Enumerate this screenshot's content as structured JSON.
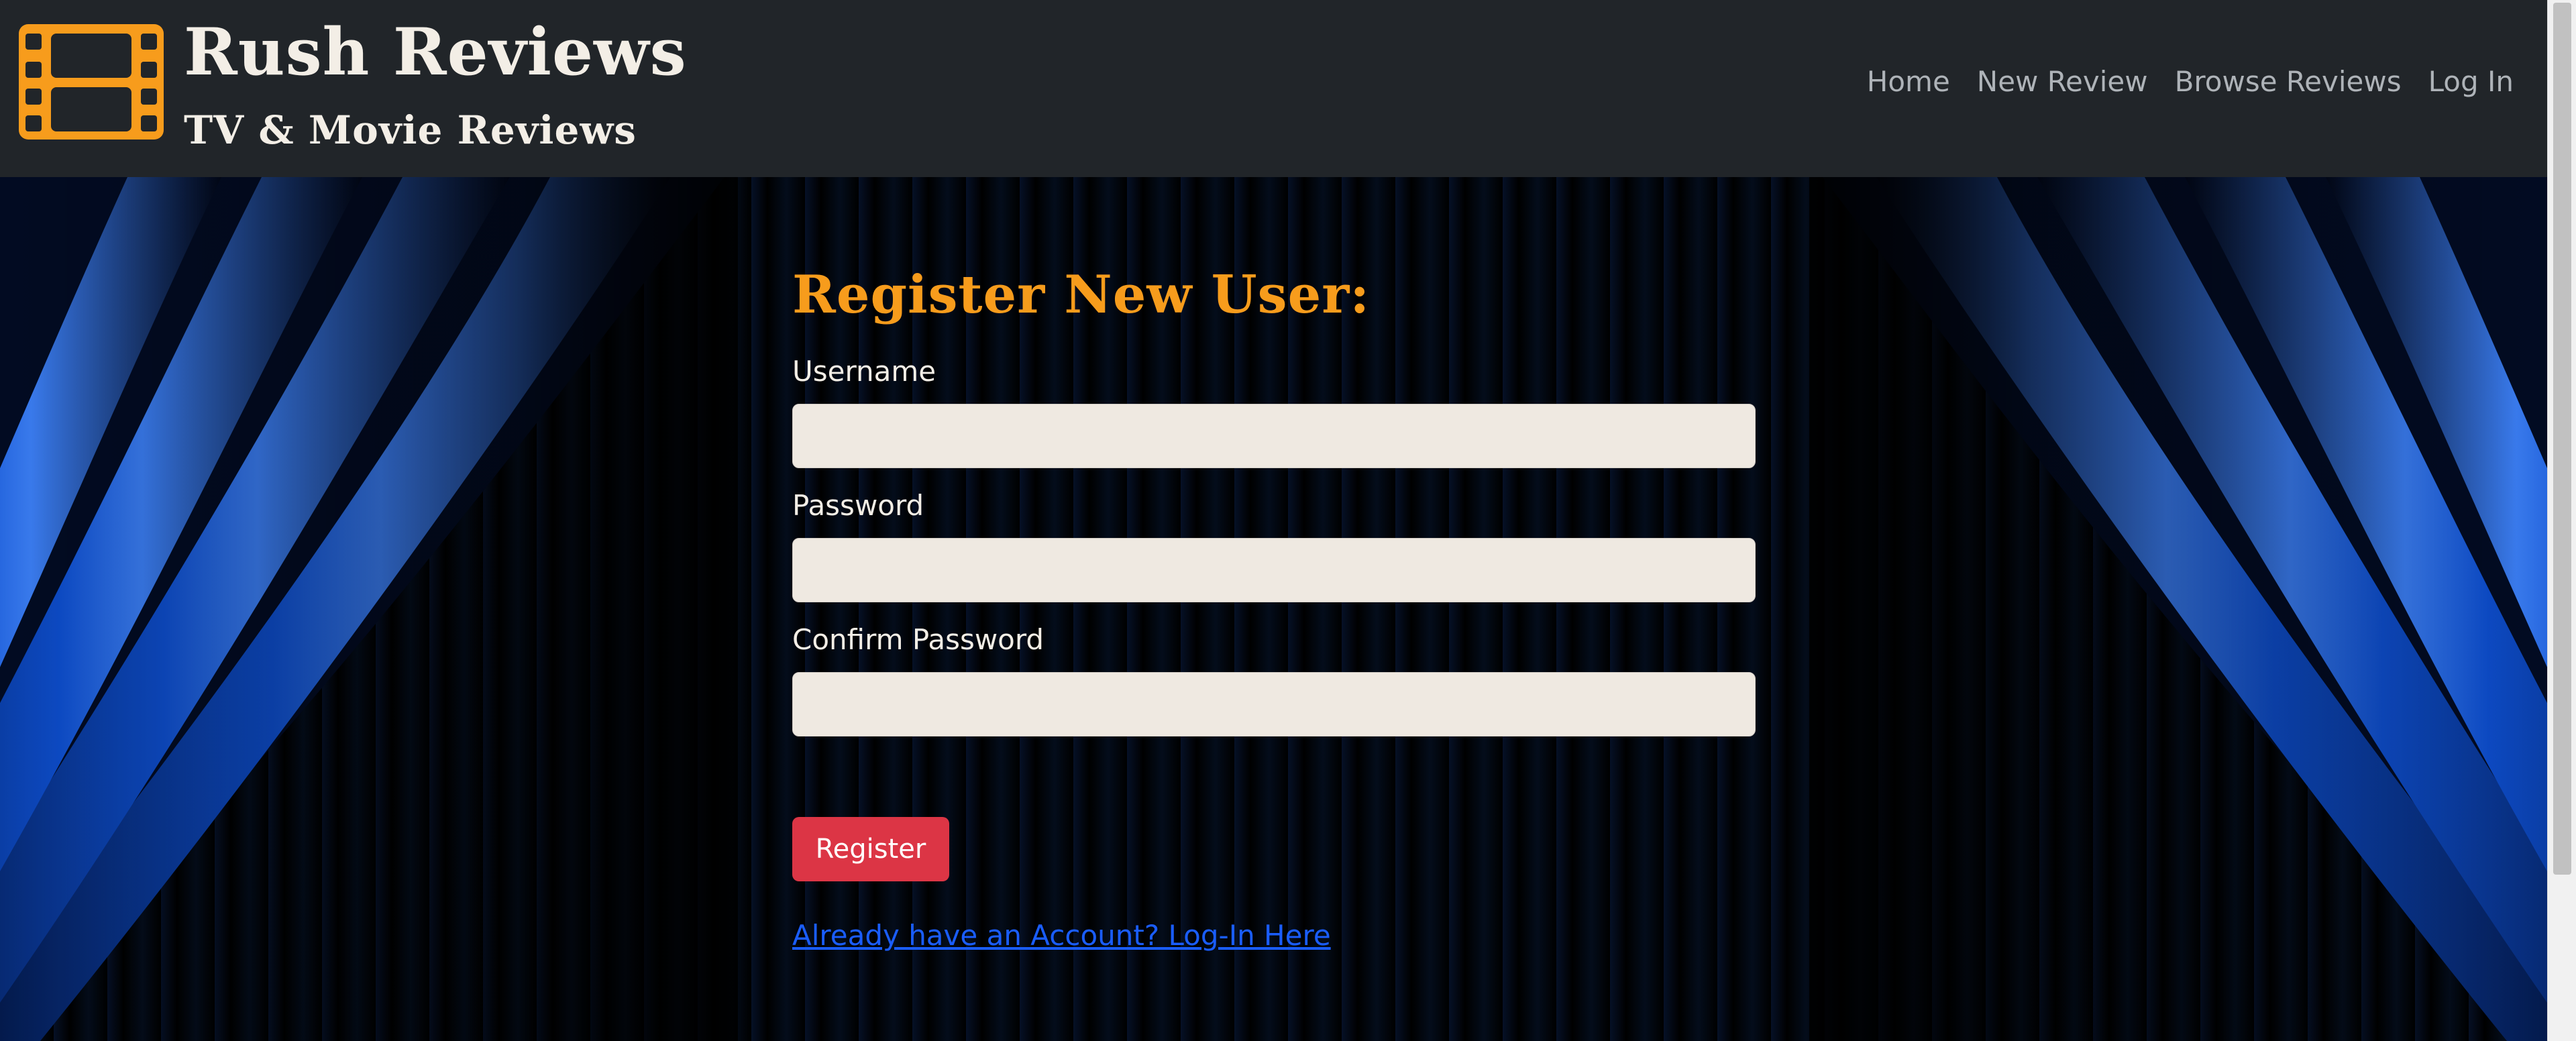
{
  "brand": {
    "title": "Rush Reviews",
    "subtitle": "TV & Movie Reviews",
    "icon": "film-strip-icon",
    "accent_color": "#f79c1c"
  },
  "nav": {
    "items": [
      {
        "label": "Home"
      },
      {
        "label": "New Review"
      },
      {
        "label": "Browse Reviews"
      },
      {
        "label": "Log In"
      }
    ]
  },
  "form": {
    "title": "Register New User:",
    "fields": [
      {
        "label": "Username",
        "value": "",
        "placeholder": ""
      },
      {
        "label": "Password",
        "value": "",
        "placeholder": ""
      },
      {
        "label": "Confirm Password",
        "value": "",
        "placeholder": ""
      }
    ],
    "submit_label": "Register",
    "submit_color": "#dc3545",
    "login_link": "Already have an Account? Log-In Here"
  }
}
